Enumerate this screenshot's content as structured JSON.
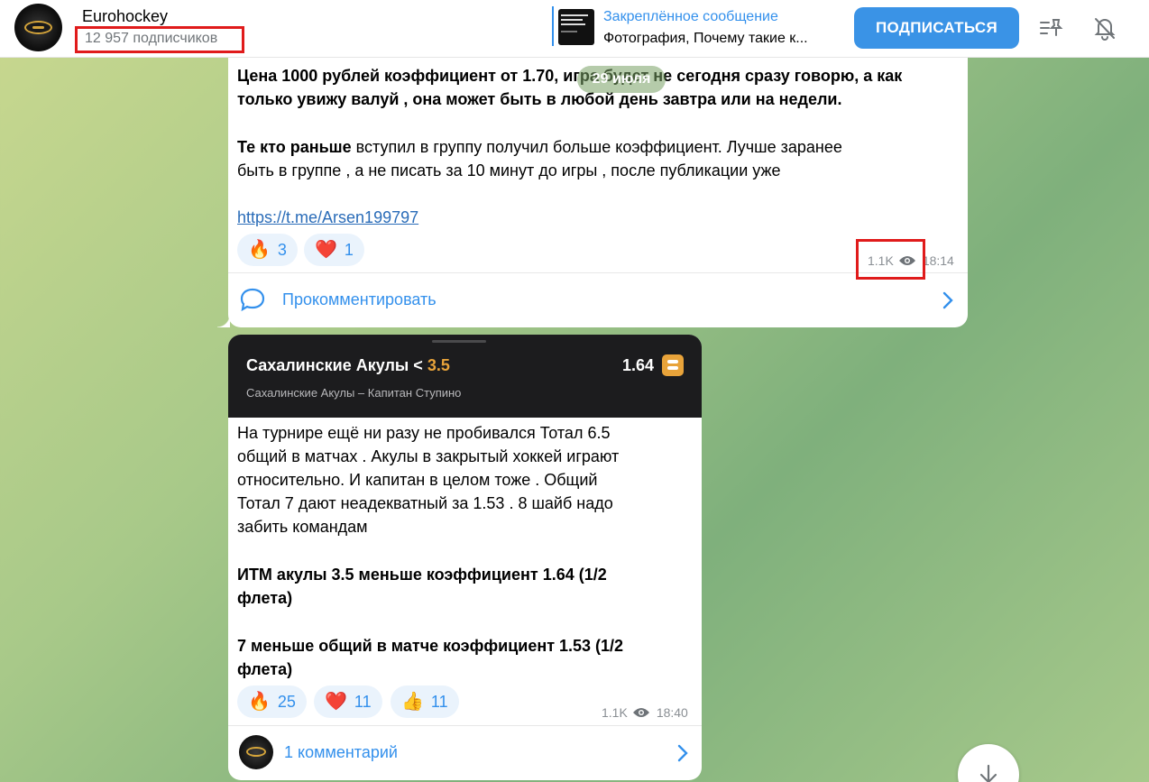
{
  "header": {
    "channel_name": "Eurohockey",
    "subscribers": "12 957 подписчиков",
    "pinned_title": "Закреплённое сообщение",
    "pinned_text": "Фотография, Почему такие к...",
    "subscribe_label": "ПОДПИСАТЬСЯ"
  },
  "date_pill": "29 июля",
  "post1": {
    "line1": "Цена 1000 рублей коэффициент от 1.70, игра будет не сегодня сразу говорю, а как",
    "line2": "только увижу валуй , она может быть в любой день завтра или на недели.",
    "line3_bold": "Те кто раньше",
    "line3_rest": " вступил в группу  получил больше коэффициент. Лучше заранее",
    "line4": "быть в группе , а не писать за 10 минут до игры , после публикации уже",
    "link": "https://t.me/Arsen199797",
    "reactions": [
      {
        "emoji": "🔥",
        "count": "3"
      },
      {
        "emoji": "❤️",
        "count": "1"
      }
    ],
    "views": "1.1K",
    "time": "18:14",
    "comment_label": "Прокомментировать"
  },
  "post2": {
    "bet_team": "Сахалинские Акулы <",
    "bet_line": "3.5",
    "bet_odds": "1.64",
    "bet_match": "Сахалинские Акулы – Капитан Ступино",
    "p1": [
      "На турнире ещё ни разу не пробивался Тотал 6.5",
      "общий в матчах . Акулы в закрытый хоккей играют",
      "относительно. И капитан в целом тоже . Общий",
      "Тотал 7 дают неадекватный за 1.53 . 8 шайб надо",
      "забить командам"
    ],
    "p2": [
      "ИТМ акулы 3.5 меньше коэффициент 1.64 (1/2",
      "флета)"
    ],
    "p3": [
      "7 меньше общий в матче коэффициент 1.53 (1/2",
      "флета)"
    ],
    "reactions": [
      {
        "emoji": "🔥",
        "count": "25"
      },
      {
        "emoji": "❤️",
        "count": "11"
      },
      {
        "emoji": "👍",
        "count": "11"
      }
    ],
    "views": "1.1K",
    "time": "18:40",
    "comment_label": "1 комментарий"
  },
  "colors": {
    "accent": "#3390ec",
    "highlight": "#e01b1b",
    "bet_accent": "#e8a33a"
  }
}
